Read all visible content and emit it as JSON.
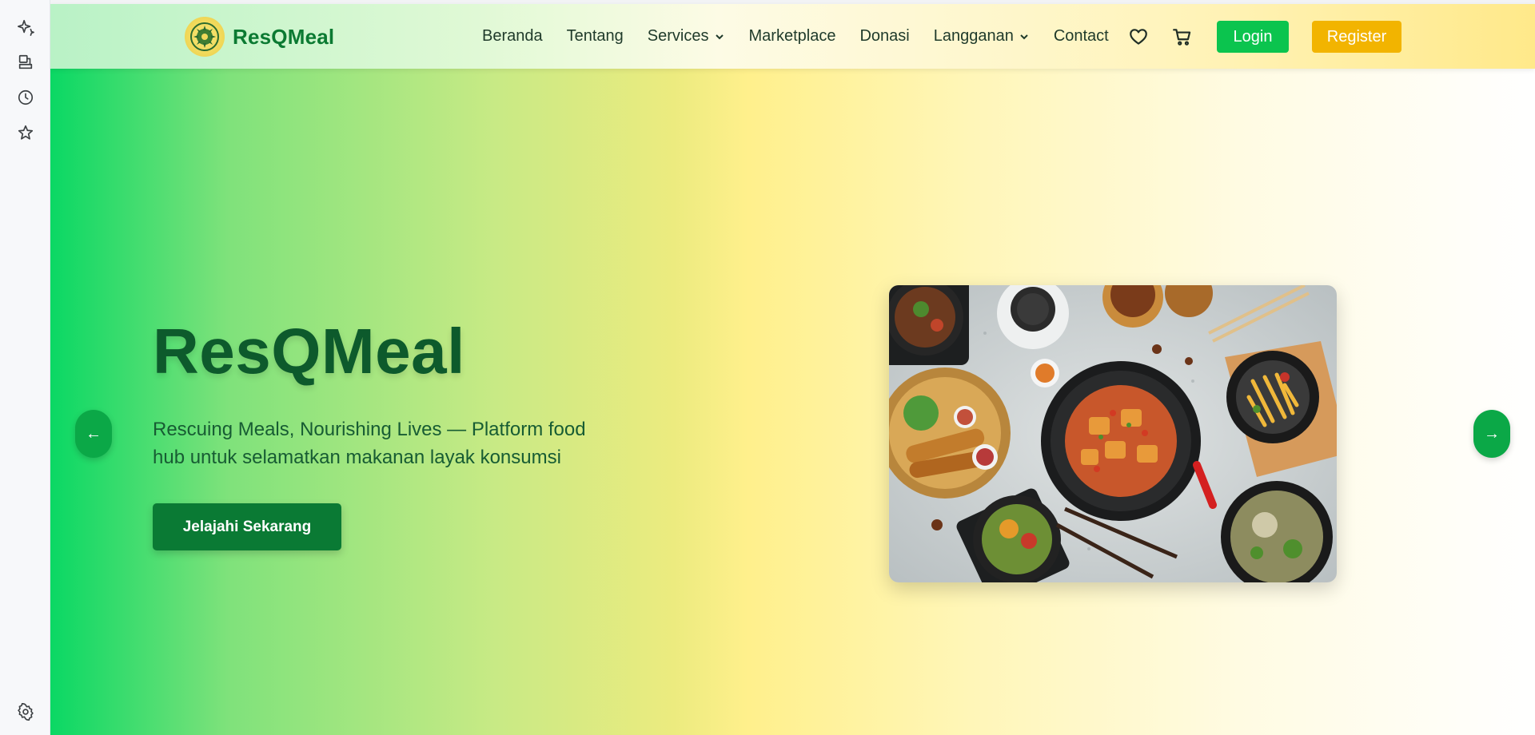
{
  "side_rail": {
    "icons": [
      "sparkle-icon",
      "bookmarks-icon",
      "history-icon",
      "star-icon",
      "gear-icon"
    ]
  },
  "navbar": {
    "brand": "ResQMeal",
    "links": [
      {
        "label": "Beranda",
        "dropdown": false
      },
      {
        "label": "Tentang",
        "dropdown": false
      },
      {
        "label": "Services",
        "dropdown": true
      },
      {
        "label": "Marketplace",
        "dropdown": false
      },
      {
        "label": "Donasi",
        "dropdown": false
      },
      {
        "label": "Langganan",
        "dropdown": true
      },
      {
        "label": "Contact",
        "dropdown": false
      }
    ],
    "icons": [
      "heart-icon",
      "cart-icon"
    ],
    "login_label": "Login",
    "register_label": "Register",
    "colors": {
      "login": "#0bc44e",
      "register": "#f2b400",
      "brand": "#0b7a32"
    }
  },
  "hero": {
    "title": "ResQMeal",
    "subtitle": "Rescuing Meals, Nourishing Lives — Platform food hub untuk selamatkan makanan layak konsumsi",
    "cta_label": "Jelajahi Sekarang",
    "prev_arrow": "←",
    "next_arrow": "→",
    "image": "food-spread-image"
  }
}
